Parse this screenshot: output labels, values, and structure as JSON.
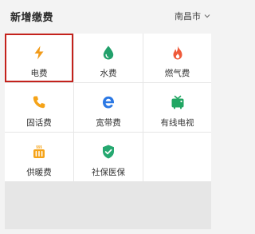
{
  "header": {
    "title": "新增缴费",
    "city": "南昌市"
  },
  "colors": {
    "electric": "#f29b1a",
    "water": "#22a06b",
    "gas": "#ef5a3a",
    "phone": "#f5a318",
    "broadband": "#2b78e4",
    "tv": "#21a663",
    "heating": "#f5a318",
    "social": "#25a870",
    "selection": "#c4221c"
  },
  "items": [
    {
      "label": "电费",
      "icon": "lightning-icon",
      "selected": true
    },
    {
      "label": "水费",
      "icon": "water-drop-icon"
    },
    {
      "label": "燃气费",
      "icon": "flame-icon"
    },
    {
      "label": "固话费",
      "icon": "phone-icon"
    },
    {
      "label": "宽带费",
      "icon": "browser-e-icon"
    },
    {
      "label": "有线电视",
      "icon": "tv-icon"
    },
    {
      "label": "供暖费",
      "icon": "heater-icon"
    },
    {
      "label": "社保医保",
      "icon": "shield-check-icon"
    }
  ]
}
